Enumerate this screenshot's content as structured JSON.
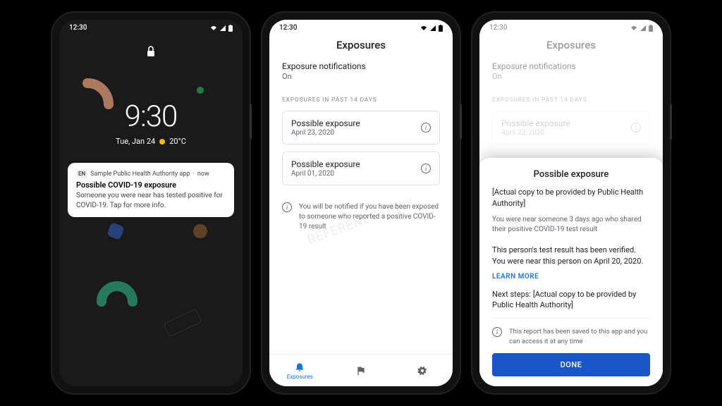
{
  "statusbar": {
    "time": "12:30"
  },
  "lockscreen": {
    "clock_time": "9:30",
    "clock_date": "Tue, Jan 24",
    "clock_temp": "20°C",
    "notif": {
      "badge": "EN",
      "source": "Sample Public Health Authority app",
      "when": "now",
      "title": "Possible COVID-19 exposure",
      "body": "Someone you were near has tested positive for COVID-19. Tap for more info."
    }
  },
  "exposures": {
    "title": "Exposures",
    "setting_label": "Exposure notifications",
    "setting_value": "On",
    "subhead": "EXPOSURES IN PAST 14 DAYS",
    "items": [
      {
        "title": "Possible exposure",
        "date": "April 23, 2020"
      },
      {
        "title": "Possible exposure",
        "date": "April 01, 2020"
      }
    ],
    "footnote": "You will be notified if you have been exposed to someone who reported a positive COVID-19 result",
    "watermark": "REFERENCE ONLY",
    "tabs": {
      "exposures": "Exposures"
    }
  },
  "sheet": {
    "title": "Possible exposure",
    "line1": "[Actual copy to be provided by Public Health Authority]",
    "line2": "You were near someone 3 days ago who shared their positive COVID-19 test result",
    "verified": "This person's test result has been verified. You were near this person on April 20, 2020.",
    "learn_more": "LEARN MORE",
    "next_steps": "Next steps: [Actual copy to be provided by Public Health Authority]",
    "saved": "This report has been saved to this app and you can access it at any time",
    "done": "DONE"
  }
}
